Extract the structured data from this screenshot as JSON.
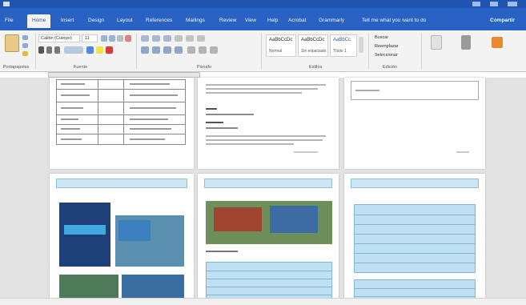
{
  "ribbon": {
    "tabs": [
      "File",
      "Home",
      "Insert",
      "Design",
      "Layout",
      "References",
      "Mailings",
      "Review",
      "View",
      "Help",
      "Acrobat",
      "Grammarly",
      "Tell me what you want to do"
    ],
    "active_tab": "Home",
    "share_label": "Compartir",
    "font_name": "Calibri (Cuerpo)",
    "font_size": "11",
    "style_normal": "AaBbCcDc",
    "style_normal_label": "Normal",
    "style_nospacing": "AaBbCcDc",
    "style_nospacing_label": "Sin espaciado",
    "style_heading": "AaBbCc",
    "style_heading_label": "Título 1",
    "find_label": "Buscar",
    "replace_label": "Reemplazar",
    "select_label": "Seleccionar",
    "groups": [
      "Portapapeles",
      "Fuente",
      "Párrafo",
      "Estilos",
      "Edición"
    ]
  },
  "colors": {
    "title_bar": "#1f55b0",
    "tab_bar": "#2a62c3",
    "ribbon": "#f3f3f3",
    "workspace": "#e3e3e3",
    "header_band": "#cde6f4",
    "table_fill": "#bfe0f2"
  }
}
